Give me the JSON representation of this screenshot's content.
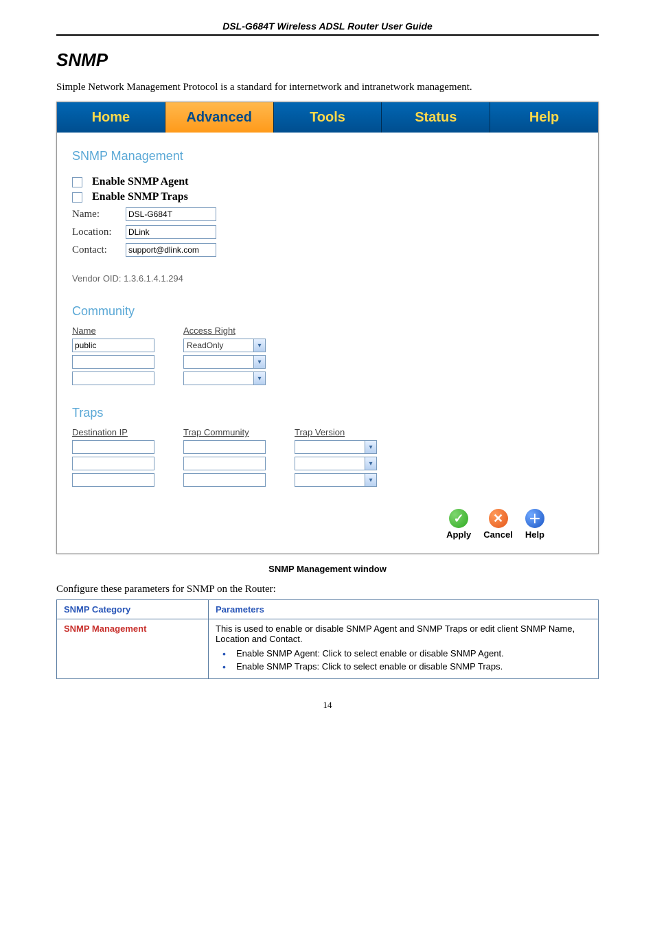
{
  "header": "DSL-G684T Wireless ADSL Router User Guide",
  "title": "SNMP",
  "intro": "Simple Network Management Protocol is a standard for internetwork and intranetwork management.",
  "tabs": {
    "home": "Home",
    "advanced": "Advanced",
    "tools": "Tools",
    "status": "Status",
    "help": "Help"
  },
  "snmp": {
    "heading": "SNMP Management",
    "enable_agent": "Enable SNMP Agent",
    "enable_traps": "Enable SNMP Traps",
    "name_label": "Name:",
    "name_value": "DSL-G684T",
    "location_label": "Location:",
    "location_value": "DLink",
    "contact_label": "Contact:",
    "contact_value": "support@dlink.com",
    "vendor_oid": "Vendor OID: 1.3.6.1.4.1.294"
  },
  "community": {
    "heading": "Community",
    "col_name": "Name",
    "col_access": "Access Right",
    "rows": [
      {
        "name": "public",
        "access": "ReadOnly"
      },
      {
        "name": "",
        "access": ""
      },
      {
        "name": "",
        "access": ""
      }
    ]
  },
  "traps": {
    "heading": "Traps",
    "col_dest": "Destination IP",
    "col_community": "Trap Community",
    "col_version": "Trap Version",
    "rows": [
      {
        "dest": "",
        "community": "",
        "version": ""
      },
      {
        "dest": "",
        "community": "",
        "version": ""
      },
      {
        "dest": "",
        "community": "",
        "version": ""
      }
    ]
  },
  "buttons": {
    "apply": "Apply",
    "cancel": "Cancel",
    "help": "Help"
  },
  "caption": "SNMP Management window",
  "configure_line": "Configure these parameters for SNMP on the Router:",
  "param_table": {
    "hdr_category": "SNMP Category",
    "hdr_params": "Parameters",
    "cat1": "SNMP Management",
    "desc1": "This is used to enable or disable SNMP Agent and SNMP Traps or edit client SNMP Name, Location and Contact.",
    "b1": "Enable SNMP Agent: Click to select enable or disable SNMP Agent.",
    "b2": "Enable SNMP Traps: Click to select enable or disable SNMP Traps."
  },
  "pagenum": "14"
}
